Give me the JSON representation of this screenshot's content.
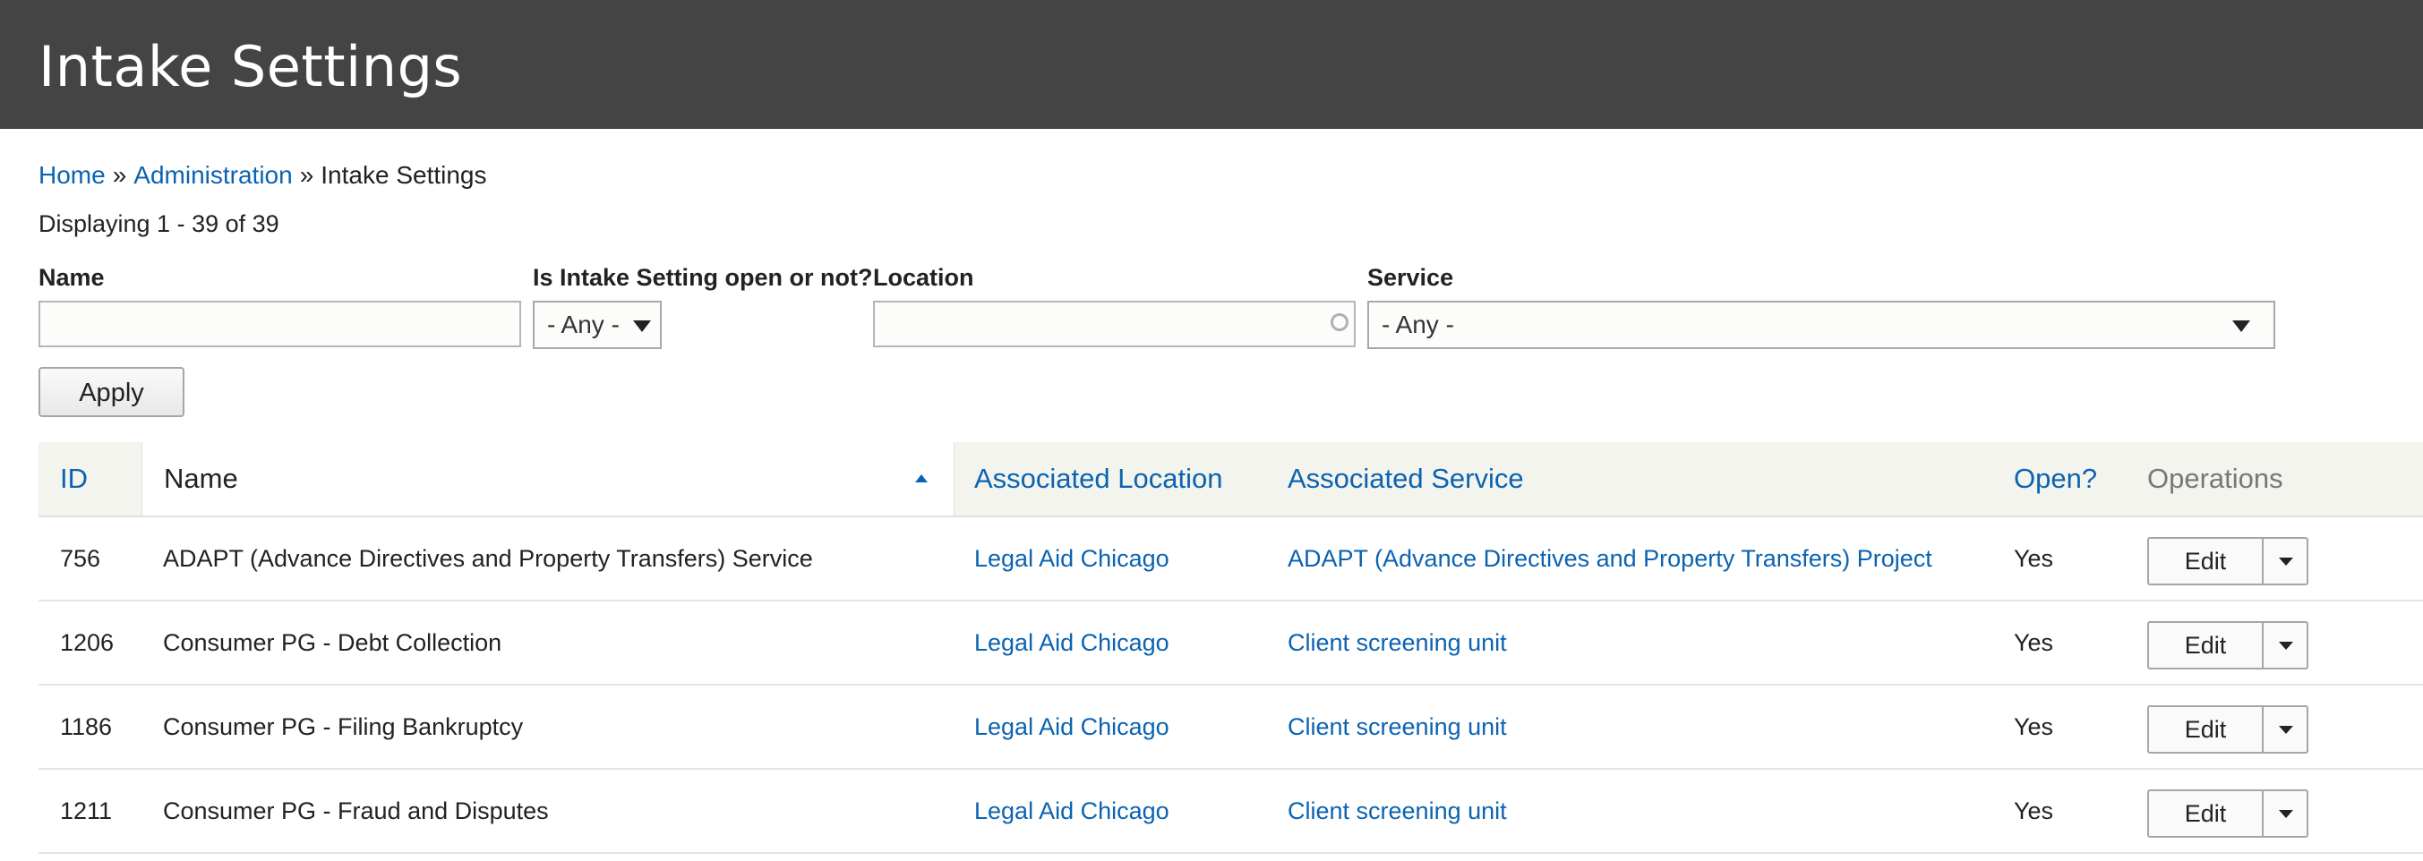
{
  "header": {
    "title": "Intake Settings"
  },
  "breadcrumb": {
    "home": "Home",
    "separator": "»",
    "admin": "Administration",
    "current": "Intake Settings"
  },
  "summary": "Displaying 1 - 39 of 39",
  "filters": {
    "name_label": "Name",
    "name_value": "",
    "open_label": "Is Intake Setting open or not?",
    "open_value": "- Any -",
    "location_label": "Location",
    "location_value": "",
    "service_label": "Service",
    "service_value": "- Any -",
    "apply_label": "Apply"
  },
  "table": {
    "headers": {
      "id": "ID",
      "name": "Name",
      "location": "Associated Location",
      "service": "Associated Service",
      "open": "Open?",
      "operations": "Operations"
    },
    "sorted_column": "name",
    "sort_direction": "ascending",
    "rows": [
      {
        "id": "756",
        "name": "ADAPT (Advance Directives and Property Transfers) Service",
        "location": "Legal Aid Chicago",
        "service": "ADAPT (Advance Directives and Property Transfers) Project",
        "open": "Yes",
        "edit": "Edit"
      },
      {
        "id": "1206",
        "name": "Consumer PG - Debt Collection",
        "location": "Legal Aid Chicago",
        "service": "Client screening unit",
        "open": "Yes",
        "edit": "Edit"
      },
      {
        "id": "1186",
        "name": "Consumer PG - Filing Bankruptcy",
        "location": "Legal Aid Chicago",
        "service": "Client screening unit",
        "open": "Yes",
        "edit": "Edit"
      },
      {
        "id": "1211",
        "name": "Consumer PG - Fraud and Disputes",
        "location": "Legal Aid Chicago",
        "service": "Client screening unit",
        "open": "Yes",
        "edit": "Edit"
      }
    ]
  },
  "colors": {
    "header_bg": "#444444",
    "link": "#0b63b1",
    "table_header_bg": "#f3f4ee"
  },
  "icons": {
    "sort": "sort-ascending-icon",
    "dropdown": "caret-down-icon",
    "autocomplete": "autocomplete-throbber-icon"
  }
}
